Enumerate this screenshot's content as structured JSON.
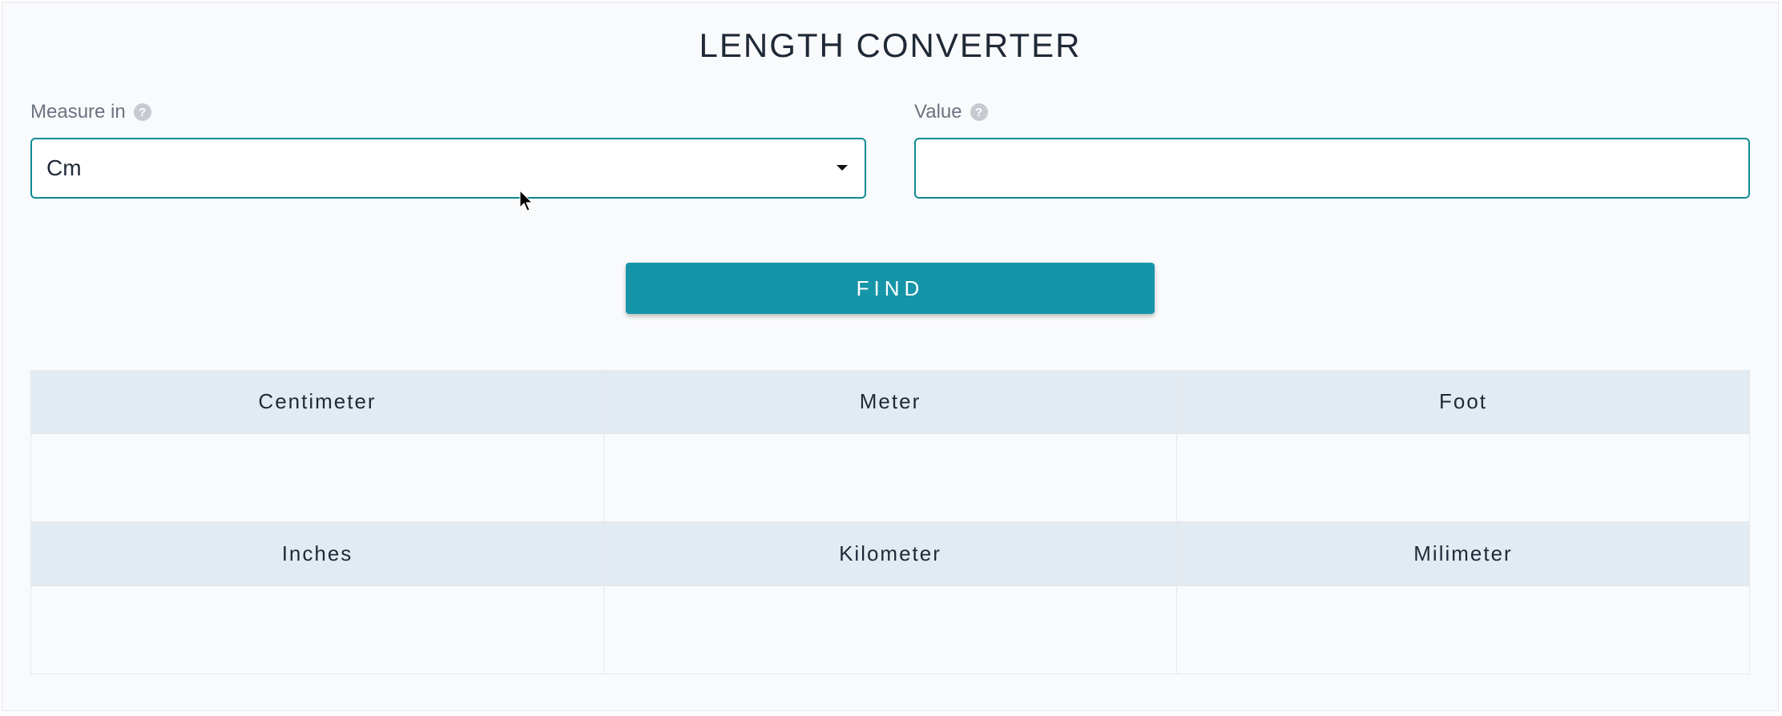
{
  "title": "LENGTH CONVERTER",
  "form": {
    "measure": {
      "label": "Measure in",
      "selected": "Cm"
    },
    "value": {
      "label": "Value",
      "current": ""
    }
  },
  "button": {
    "find": "FIND"
  },
  "results": {
    "cells": [
      {
        "label": "Centimeter",
        "value": ""
      },
      {
        "label": "Meter",
        "value": ""
      },
      {
        "label": "Foot",
        "value": ""
      },
      {
        "label": "Inches",
        "value": ""
      },
      {
        "label": "Kilometer",
        "value": ""
      },
      {
        "label": "Milimeter",
        "value": ""
      }
    ]
  }
}
